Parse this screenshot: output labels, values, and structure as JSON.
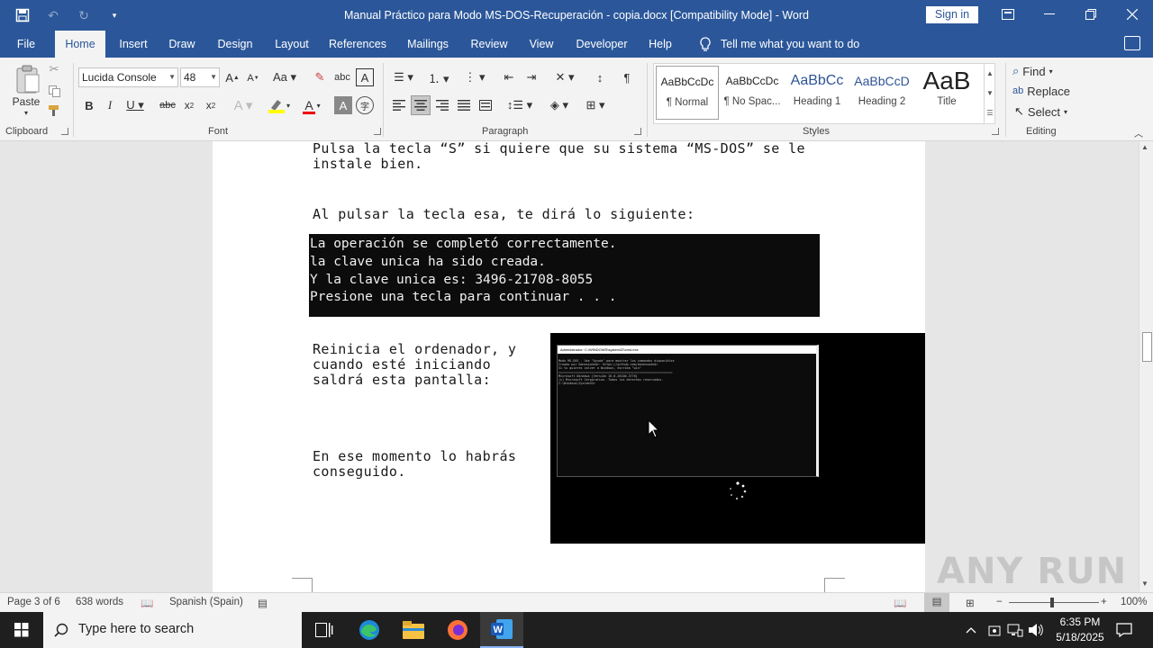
{
  "titlebar": {
    "title": "Manual Práctico para Modo MS-DOS-Recuperación - copia.docx [Compatibility Mode]  -  Word",
    "signin": "Sign in"
  },
  "tabs": [
    "File",
    "Home",
    "Insert",
    "Draw",
    "Design",
    "Layout",
    "References",
    "Mailings",
    "Review",
    "View",
    "Developer",
    "Help"
  ],
  "tellme": "Tell me what you want to do",
  "ribbon": {
    "clipboard": {
      "paste": "Paste",
      "label": "Clipboard"
    },
    "font": {
      "name": "Lucida Console",
      "size": "48",
      "label": "Font"
    },
    "paragraph": {
      "label": "Paragraph"
    },
    "styles": {
      "label": "Styles",
      "items": [
        {
          "preview": "AaBbCcDc",
          "name": "¶ Normal"
        },
        {
          "preview": "AaBbCcDc",
          "name": "¶ No Spac..."
        },
        {
          "preview": "AaBbCc",
          "name": "Heading 1"
        },
        {
          "preview": "AaBbCcD",
          "name": "Heading 2"
        },
        {
          "preview": "AaB",
          "name": "Title"
        }
      ]
    },
    "editing": {
      "find": "Find",
      "replace": "Replace",
      "select": "Select",
      "label": "Editing"
    }
  },
  "document": {
    "p1": "Pulsa la tecla “S” si quiere que su sistema “MS-DOS” se le\ninstale bien.",
    "p2": "Al pulsar la tecla esa, te dirá lo siguiente:",
    "cmd": [
      "La operación se completó correctamente.",
      "la clave unica ha sido creada.",
      "Y la clave unica es: 3496-21708-8055",
      "Presione una tecla para continuar . . ."
    ],
    "p3": "Reinicia el ordenador, y\ncuando esté iniciando\nsaldrá esta pantalla:",
    "p4": "En ese momento lo habrás\nconseguido.",
    "screenshot": {
      "title": "Administrador: C:\\WINDOWS\\system32\\cmd.exe",
      "lines": [
        "Modo MS-DOS - Use \"Ayuda\" para mostrar los comandos disponibles",
        "Creado por Danessa4ndr: https://github.com/danessa4ndr",
        "Si tu quieres volver a Windows, escriba \"win\"",
        "",
        "==============================================================",
        "",
        "",
        "Microsoft Windows [Versión 10.0.26100.3776]",
        "(c) Microsoft Corporation. Todos los derechos reservados.",
        "",
        "C:\\Windows\\System32>"
      ]
    }
  },
  "status": {
    "page": "Page 3 of 6",
    "words": "638 words",
    "language": "Spanish (Spain)",
    "zoom": "100%"
  },
  "taskbar": {
    "search_placeholder": "Type here to search",
    "time": "6:35 PM",
    "date": "5/18/2025"
  },
  "watermark": "ANY RUN"
}
